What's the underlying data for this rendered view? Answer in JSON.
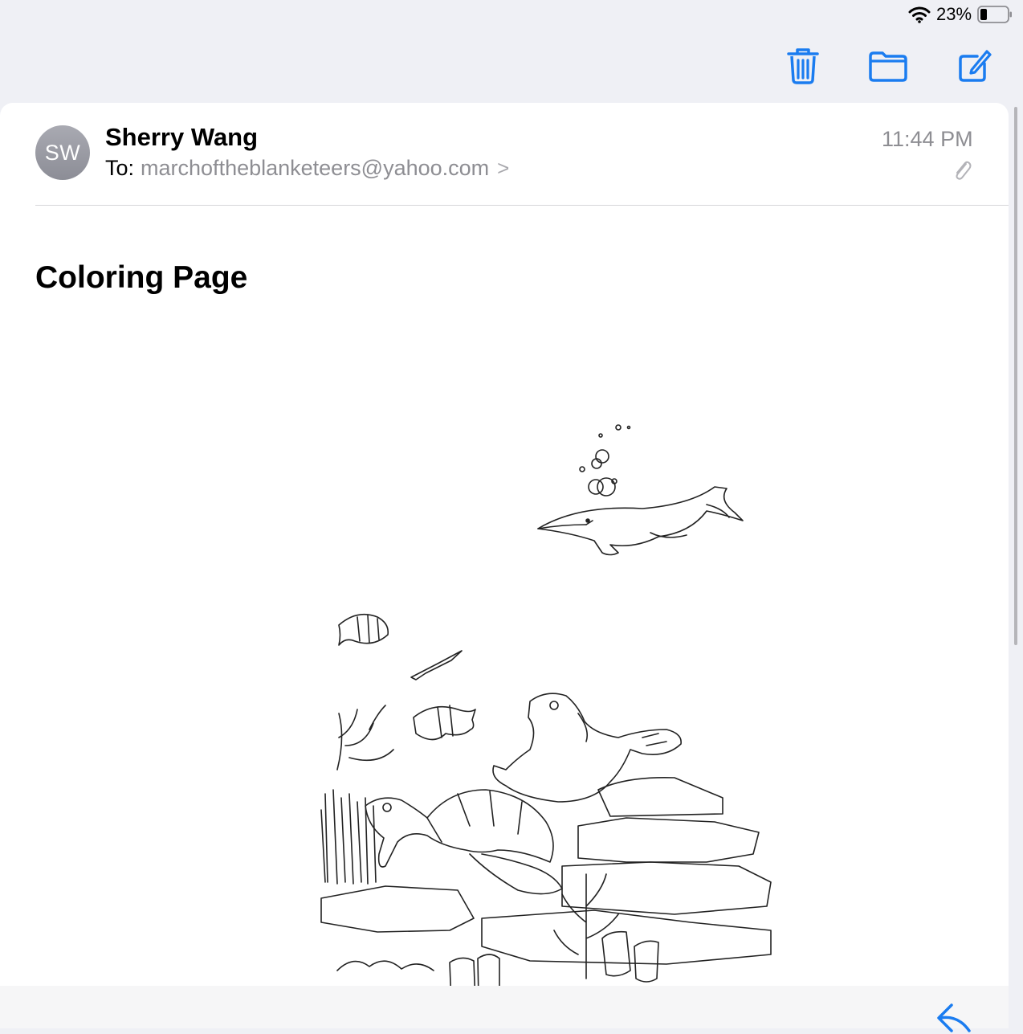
{
  "status_bar": {
    "battery_percent": "23%",
    "battery_level": 0.23,
    "wifi_icon": "wifi-icon"
  },
  "toolbar": {
    "icons": [
      "trash-icon",
      "folder-icon",
      "compose-icon"
    ],
    "accent_color": "#1a7cf0"
  },
  "message": {
    "avatar_initials": "SW",
    "sender": "Sherry Wang",
    "to_label": "To:",
    "to_address": "marchoftheblanketeers@yahoo.com",
    "to_chevron": ">",
    "time": "11:44 PM",
    "attachment_icon": "paperclip-icon",
    "subject": "Coloring Page",
    "attachment_image": "underwater coloring page drawing"
  },
  "bottom_bar": {
    "reply_icon": "reply-icon"
  }
}
